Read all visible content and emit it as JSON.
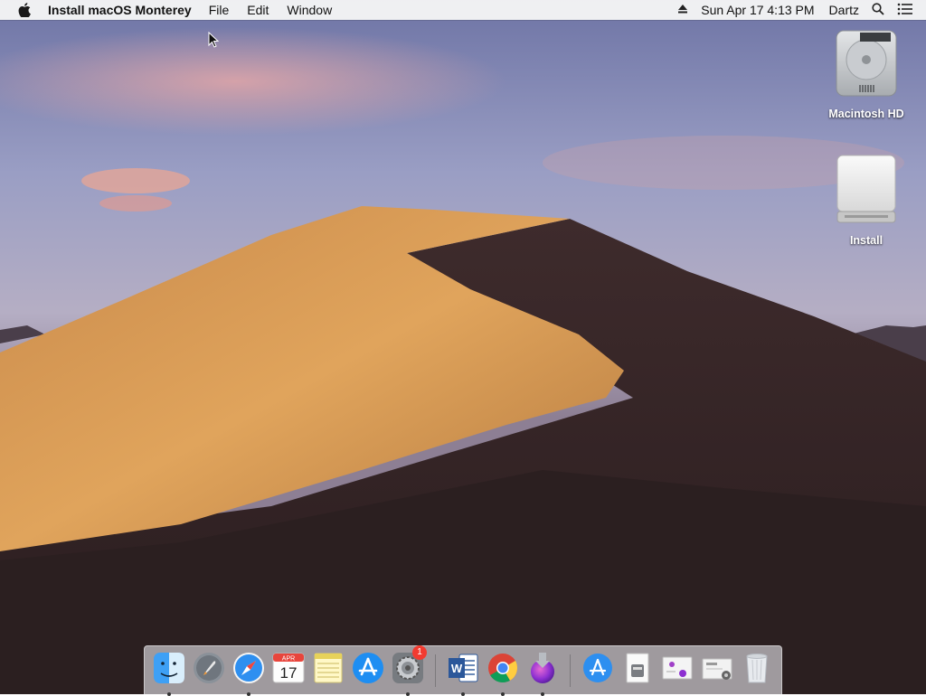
{
  "menubar": {
    "app_name": "Install macOS Monterey",
    "menus": [
      "File",
      "Edit",
      "Window"
    ],
    "clock": "Sun Apr 17  4:13 PM",
    "user": "Dartz"
  },
  "desktop": {
    "icons": [
      {
        "label": "Macintosh HD",
        "icon": "hard-drive-icon"
      },
      {
        "label": "Install",
        "icon": "external-drive-icon"
      }
    ]
  },
  "dock": {
    "calendar": {
      "month": "APR",
      "day": "17"
    },
    "system_preferences_badge": "1",
    "apps": [
      {
        "name": "Finder",
        "icon": "finder-icon",
        "running": true
      },
      {
        "name": "Launchpad",
        "icon": "launchpad-icon",
        "running": false
      },
      {
        "name": "Safari",
        "icon": "safari-icon",
        "running": true
      },
      {
        "name": "Calendar",
        "icon": "calendar-icon",
        "running": false
      },
      {
        "name": "Notes",
        "icon": "notes-icon",
        "running": false
      },
      {
        "name": "App Store",
        "icon": "app-store-icon",
        "running": false
      },
      {
        "name": "System Preferences",
        "icon": "system-preferences-icon",
        "running": true
      },
      {
        "name": "Microsoft Word",
        "icon": "word-icon",
        "running": true
      },
      {
        "name": "Google Chrome",
        "icon": "chrome-icon",
        "running": true
      },
      {
        "name": "Install macOS Monterey",
        "icon": "monterey-installer-icon",
        "running": true
      }
    ]
  },
  "colors": {
    "menubar_bg": "#f5f5f5",
    "badge_red": "#f23b30",
    "dune_light": "#d99a52",
    "dune_dark": "#3a2a2a"
  }
}
